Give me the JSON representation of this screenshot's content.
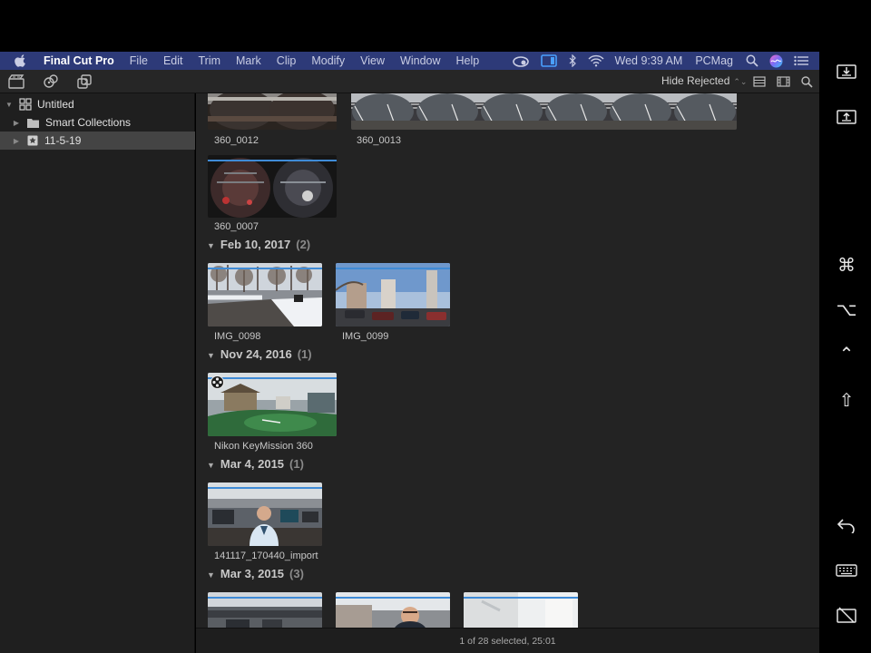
{
  "menubar": {
    "app_name": "Final Cut Pro",
    "items": [
      "File",
      "Edit",
      "Trim",
      "Mark",
      "Clip",
      "Modify",
      "View",
      "Window",
      "Help"
    ],
    "clock": "Wed 9:39 AM",
    "user": "PCMag",
    "color": "#2d3a78"
  },
  "toolbar": {
    "filter_label": "Hide Rejected"
  },
  "sidebar": {
    "library": "Untitled",
    "smart_collections": "Smart Collections",
    "event": "11-5-19"
  },
  "browser": {
    "top_clips": [
      "360_0012",
      "360_0013",
      "360_0007"
    ],
    "groups": [
      {
        "date": "Feb 10, 2017",
        "count": "(2)",
        "clips": [
          "IMG_0098",
          "IMG_0099"
        ]
      },
      {
        "date": "Nov 24, 2016",
        "count": "(1)",
        "clips": [
          "Nikon KeyMission 360"
        ]
      },
      {
        "date": "Mar 4, 2015",
        "count": "(1)",
        "clips": [
          "141117_170440_import"
        ]
      },
      {
        "date": "Mar 3, 2015",
        "count": "(3)",
        "clips": []
      }
    ],
    "accent": "#3f8bd6"
  },
  "status": {
    "text": "1 of 28 selected, 25:01"
  },
  "sidecar": {
    "icons": [
      "download-icon",
      "upload-icon",
      "command-icon",
      "option-icon",
      "control-icon",
      "shift-icon",
      "undo-icon",
      "keyboard-icon",
      "disconnect-icon"
    ]
  }
}
